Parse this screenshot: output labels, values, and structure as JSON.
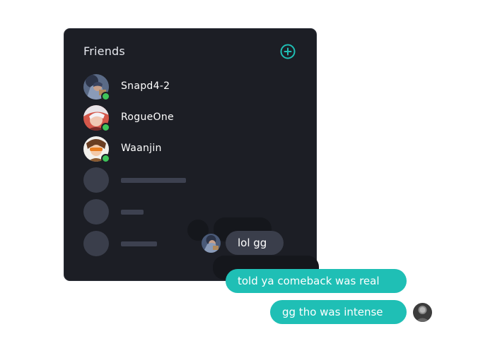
{
  "panel": {
    "title": "Friends",
    "add_icon": "plus-circle-icon"
  },
  "friends": [
    {
      "name": "Snapd4-2",
      "status": "online",
      "status_color": "#3ec45a"
    },
    {
      "name": "RogueOne",
      "status": "online",
      "status_color": "#3ec45a"
    },
    {
      "name": "Waanjin",
      "status": "online",
      "status_color": "#3ec45a"
    }
  ],
  "chat": {
    "messages": [
      {
        "text": "lol gg",
        "from": "friend"
      },
      {
        "text": "told ya comeback was real",
        "from": "me"
      },
      {
        "text": "gg tho was intense",
        "from": "me"
      }
    ]
  },
  "colors": {
    "accent": "#1fbfb5",
    "panel_bg": "#1c1e25",
    "online": "#3ec45a",
    "bubble_dark": "#3a3e4b"
  }
}
